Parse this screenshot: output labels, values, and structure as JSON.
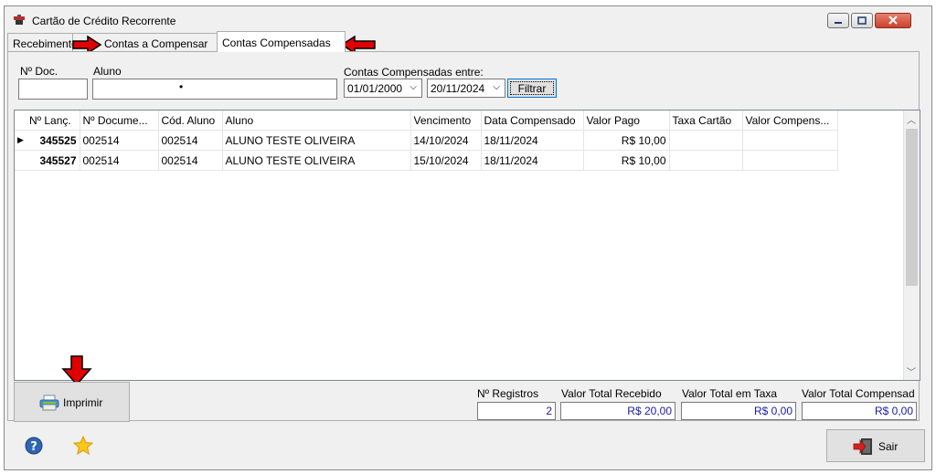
{
  "window": {
    "title": "Cartão de Crédito Recorrente"
  },
  "tabs": [
    {
      "label": "Recebimentos",
      "active": false
    },
    {
      "label": "Contas a Compensar",
      "active": false
    },
    {
      "label": "Contas Compensadas",
      "active": true
    }
  ],
  "filters": {
    "doc_label": "Nº Doc.",
    "doc_value": "",
    "aluno_label": "Aluno",
    "aluno_value": "•",
    "range_label": "Contas Compensadas entre:",
    "date_from": "01/01/2000",
    "date_to": "20/11/2024",
    "filter_button": "Filtrar"
  },
  "table": {
    "columns": [
      "Nº Lanç.",
      "Nº Docume...",
      "Cód. Aluno",
      "Aluno",
      "Vencimento",
      "Data Compensado",
      "Valor Pago",
      "Taxa Cartão",
      "Valor Compens..."
    ],
    "rows": [
      {
        "indicator": "▶",
        "lanc": "345525",
        "documento": "002514",
        "cod_aluno": "002514",
        "aluno": "ALUNO TESTE OLIVEIRA",
        "vencimento": "14/10/2024",
        "data_compensado": "18/11/2024",
        "valor_pago": "R$ 10,00",
        "taxa_cartao": "",
        "valor_compensado": ""
      },
      {
        "indicator": "",
        "lanc": "345527",
        "documento": "002514",
        "cod_aluno": "002514",
        "aluno": "ALUNO TESTE OLIVEIRA",
        "vencimento": "15/10/2024",
        "data_compensado": "18/11/2024",
        "valor_pago": "R$ 10,00",
        "taxa_cartao": "",
        "valor_compensado": ""
      }
    ]
  },
  "print_button": "Imprimir",
  "summary": {
    "registros_label": "Nº Registros",
    "registros_value": "2",
    "recebido_label": "Valor Total Recebido",
    "recebido_value": "R$ 20,00",
    "taxa_label": "Valor Total em Taxa",
    "taxa_value": "R$ 0,00",
    "compensado_label": "Valor Total Compensad",
    "compensado_value": "R$ 0,00"
  },
  "exit_button": "Sair",
  "colors": {
    "accent": "#0078d7",
    "annotation_arrow": "#e00000",
    "summary_text": "#1a1aa6"
  },
  "icons": [
    "title-app-icon",
    "minimize-icon",
    "maximize-icon",
    "close-icon",
    "calendar-dropdown-icon",
    "printer-icon",
    "help-icon",
    "favorite-star-icon",
    "exit-door-icon"
  ]
}
